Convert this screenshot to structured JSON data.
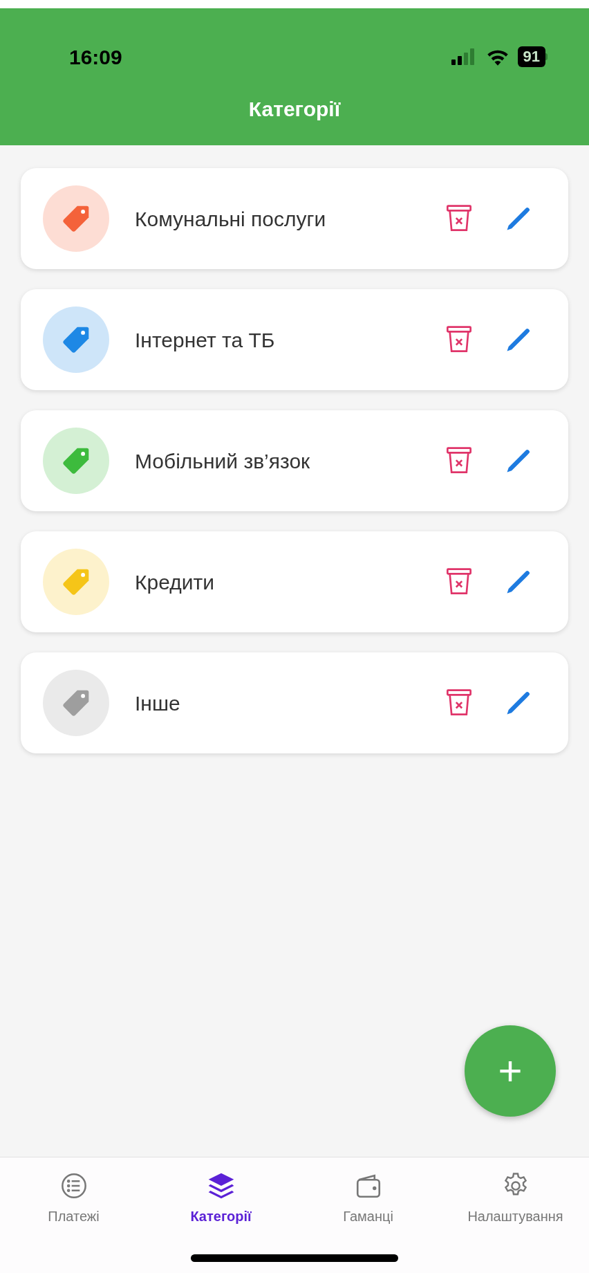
{
  "status_bar": {
    "time": "16:09",
    "battery": "91"
  },
  "header": {
    "title": "Категорії"
  },
  "categories": [
    {
      "name": "Комунальні послуги",
      "color": "#f4623a"
    },
    {
      "name": "Інтернет та ТБ",
      "color": "#1e88e5"
    },
    {
      "name": "Мобільний зв’язок",
      "color": "#3dbb3d"
    },
    {
      "name": "Кредити",
      "color": "#f5c518"
    },
    {
      "name": "Інше",
      "color": "#9e9e9e"
    }
  ],
  "fab": {
    "label": "+"
  },
  "tabs": [
    {
      "kind": "list",
      "label": "Платежі",
      "selected": false
    },
    {
      "kind": "layers",
      "label": "Категорії",
      "selected": true
    },
    {
      "kind": "wallet",
      "label": "Гаманці",
      "selected": false
    },
    {
      "kind": "gear",
      "label": "Налаштування",
      "selected": false
    }
  ]
}
